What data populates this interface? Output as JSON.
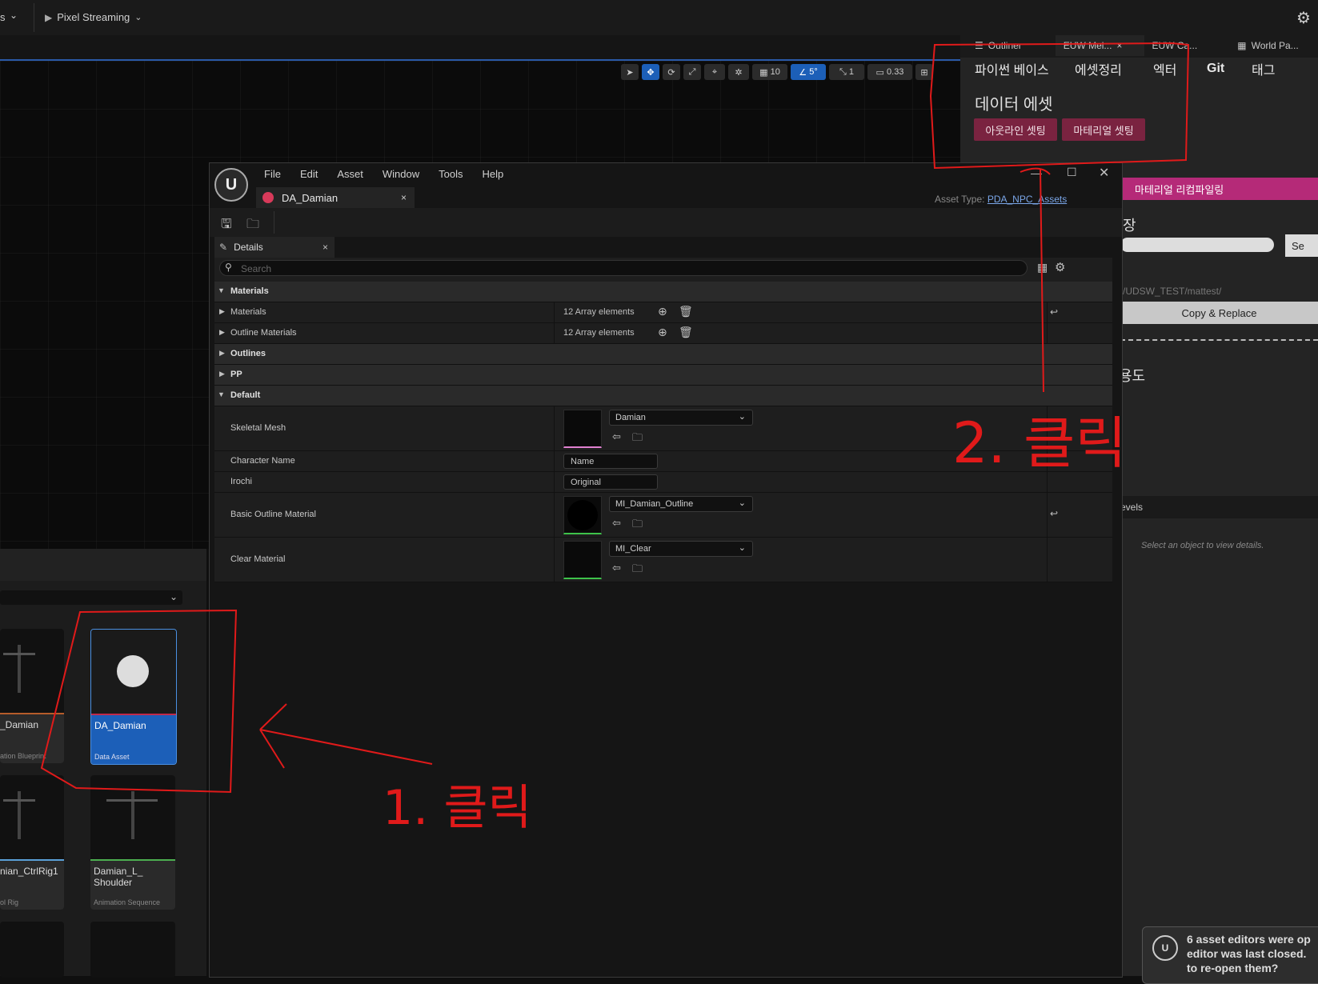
{
  "topbar": {
    "left_menu_fragment": "s",
    "pixel_streaming_label": "Pixel Streaming"
  },
  "viewport_toolbar": {
    "grid_value": "10",
    "angle_value": "5°",
    "scale_value": "1",
    "camera_speed": "0.33"
  },
  "right_panel": {
    "tabs": [
      {
        "label": "Outliner"
      },
      {
        "label": "EUW Mel..."
      },
      {
        "label": "EUW Ca..."
      },
      {
        "label": "World Pa..."
      }
    ],
    "kr_tabs": [
      {
        "label": "파이썬 베이스"
      },
      {
        "label": "에셋정리"
      },
      {
        "label": "엑터"
      },
      {
        "label": "Git"
      },
      {
        "label": "태그"
      }
    ],
    "section_title": "데이터 에셋",
    "buttons": {
      "outline_setting": "아웃라인 셋팅",
      "material_setting": "마테리얼 셋팅",
      "material_refiling": "마테리얼 리컴파일링",
      "copy_replace": "Copy & Replace",
      "se": "Se"
    },
    "heading_jang": "장",
    "path_text": "/UDSW_TEST/mattest/",
    "heading_yongdo": "용도",
    "levels_label": "evels",
    "details_hint": "Select an object to view details."
  },
  "editor": {
    "menu": [
      {
        "label": "File"
      },
      {
        "label": "Edit"
      },
      {
        "label": "Asset"
      },
      {
        "label": "Window"
      },
      {
        "label": "Tools"
      },
      {
        "label": "Help"
      }
    ],
    "tab_title": "DA_Damian",
    "asset_type_label": "Asset Type:",
    "asset_type_value": "PDA_NPC_Assets",
    "details_tab": "Details",
    "search_placeholder": "Search",
    "rows": {
      "materials_category": "Materials",
      "materials": "Materials",
      "materials_value": "12 Array elements",
      "outline_materials": "Outline Materials",
      "outline_materials_value": "12 Array elements",
      "outlines": "Outlines",
      "pp": "PP",
      "default_category": "Default",
      "skeletal_mesh": "Skeletal Mesh",
      "skeletal_mesh_value": "Damian",
      "character_name": "Character Name",
      "character_name_value": "Name",
      "irochi": "Irochi",
      "irochi_value": "Original",
      "basic_outline_material": "Basic Outline Material",
      "basic_outline_material_value": "MI_Damian_Outline",
      "clear_material": "Clear Material",
      "clear_material_value": "MI_Clear"
    }
  },
  "content_browser": {
    "items": [
      {
        "name": "_Damian",
        "type": "ation Blueprint"
      },
      {
        "name": "DA_Damian",
        "type": "Data Asset"
      },
      {
        "name": "nian_CtrlRig1",
        "type": "ol Rig"
      },
      {
        "name": "Damian_L_\nShoulder",
        "type": "Animation Sequence"
      }
    ]
  },
  "toast": {
    "message": "6 asset editors were op\neditor was last closed.\nto re-open them?"
  },
  "annotations": {
    "step1": "1. 클릭",
    "step2": "2. 클릭"
  },
  "colors": {
    "selection_blue": "#1c5fb8",
    "pink_button": "#7a2340",
    "magenta_button": "#b52a78",
    "annotation_red": "#e01a1a"
  }
}
